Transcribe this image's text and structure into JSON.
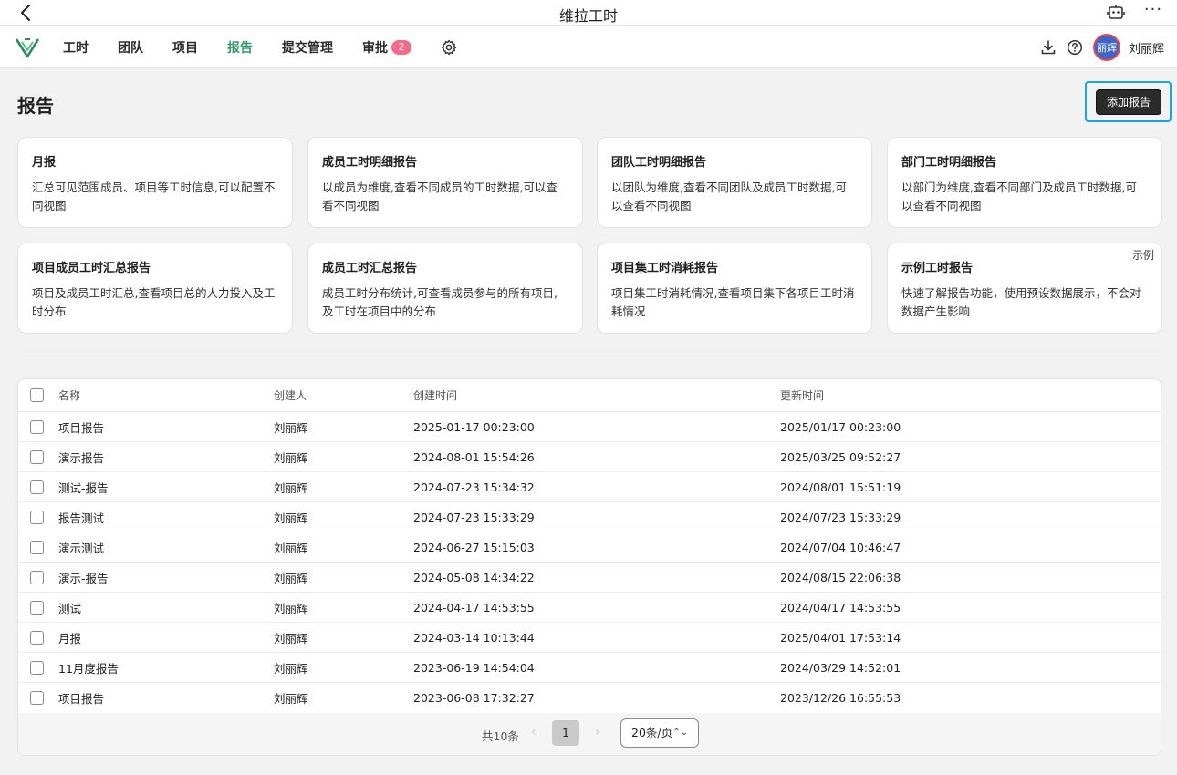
{
  "window": {
    "title": "维拉工时"
  },
  "nav": {
    "items": [
      {
        "label": "工时"
      },
      {
        "label": "团队"
      },
      {
        "label": "项目"
      },
      {
        "label": "报告"
      },
      {
        "label": "提交管理"
      },
      {
        "label": "审批",
        "badge": "2"
      }
    ],
    "active_color": "#3a9a6c",
    "badge_color": "#f56a89",
    "avatar_text": "丽辉",
    "username": "刘丽辉"
  },
  "page": {
    "title": "报告",
    "add_button": "添加报告"
  },
  "cards": [
    {
      "title": "月报",
      "desc": "汇总可见范围成员、项目等工时信息,可以配置不同视图"
    },
    {
      "title": "成员工时明细报告",
      "desc": "以成员为维度,查看不同成员的工时数据,可以查看不同视图"
    },
    {
      "title": "团队工时明细报告",
      "desc": "以团队为维度,查看不同团队及成员工时数据,可以查看不同视图"
    },
    {
      "title": "部门工时明细报告",
      "desc": "以部门为维度,查看不同部门及成员工时数据,可以查看不同视图"
    },
    {
      "title": "项目成员工时汇总报告",
      "desc": "项目及成员工时汇总,查看项目总的人力投入及工时分布"
    },
    {
      "title": "成员工时汇总报告",
      "desc": "成员工时分布统计,可查看成员参与的所有项目,及工时在项目中的分布"
    },
    {
      "title": "项目集工时消耗报告",
      "desc": "项目集工时消耗情况,查看项目集下各项目工时消耗情况"
    },
    {
      "title": "示例工时报告",
      "desc": "快速了解报告功能，使用预设数据展示，不会对数据产生影响",
      "tag": "示例"
    }
  ],
  "table": {
    "columns": {
      "name": "名称",
      "creator": "创建人",
      "created": "创建时间",
      "updated": "更新时间"
    },
    "rows": [
      {
        "name": "项目报告",
        "creator": "刘丽辉",
        "created": "2025-01-17 00:23:00",
        "updated": "2025/01/17 00:23:00"
      },
      {
        "name": "演示报告",
        "creator": "刘丽辉",
        "created": "2024-08-01 15:54:26",
        "updated": "2025/03/25 09:52:27"
      },
      {
        "name": "测试-报告",
        "creator": "刘丽辉",
        "created": "2024-07-23 15:34:32",
        "updated": "2024/08/01 15:51:19"
      },
      {
        "name": "报告测试",
        "creator": "刘丽辉",
        "created": "2024-07-23 15:33:29",
        "updated": "2024/07/23 15:33:29"
      },
      {
        "name": "演示测试",
        "creator": "刘丽辉",
        "created": "2024-06-27 15:15:03",
        "updated": "2024/07/04 10:46:47"
      },
      {
        "name": "演示-报告",
        "creator": "刘丽辉",
        "created": "2024-05-08 14:34:22",
        "updated": "2024/08/15 22:06:38"
      },
      {
        "name": "测试",
        "creator": "刘丽辉",
        "created": "2024-04-17 14:53:55",
        "updated": "2024/04/17 14:53:55"
      },
      {
        "name": "月报",
        "creator": "刘丽辉",
        "created": "2024-03-14 10:13:44",
        "updated": "2025/04/01 17:53:14"
      },
      {
        "name": "11月度报告",
        "creator": "刘丽辉",
        "created": "2023-06-19 14:54:04",
        "updated": "2024/03/29 14:52:01"
      },
      {
        "name": "项目报告",
        "creator": "刘丽辉",
        "created": "2023-06-08 17:32:27",
        "updated": "2023/12/26 16:55:53"
      }
    ]
  },
  "pagination": {
    "total": "共10条",
    "current_page": "1",
    "page_size": "20条/页"
  },
  "icons": [
    "back-icon",
    "robot-icon",
    "more-icon",
    "logo-icon",
    "gear-icon",
    "download-icon",
    "help-icon",
    "chevron-left-icon",
    "chevron-right-icon",
    "updown-icon"
  ],
  "colors": {
    "highlight_border": "#1aa3e8",
    "add_button_bg": "#2b2b2b"
  }
}
